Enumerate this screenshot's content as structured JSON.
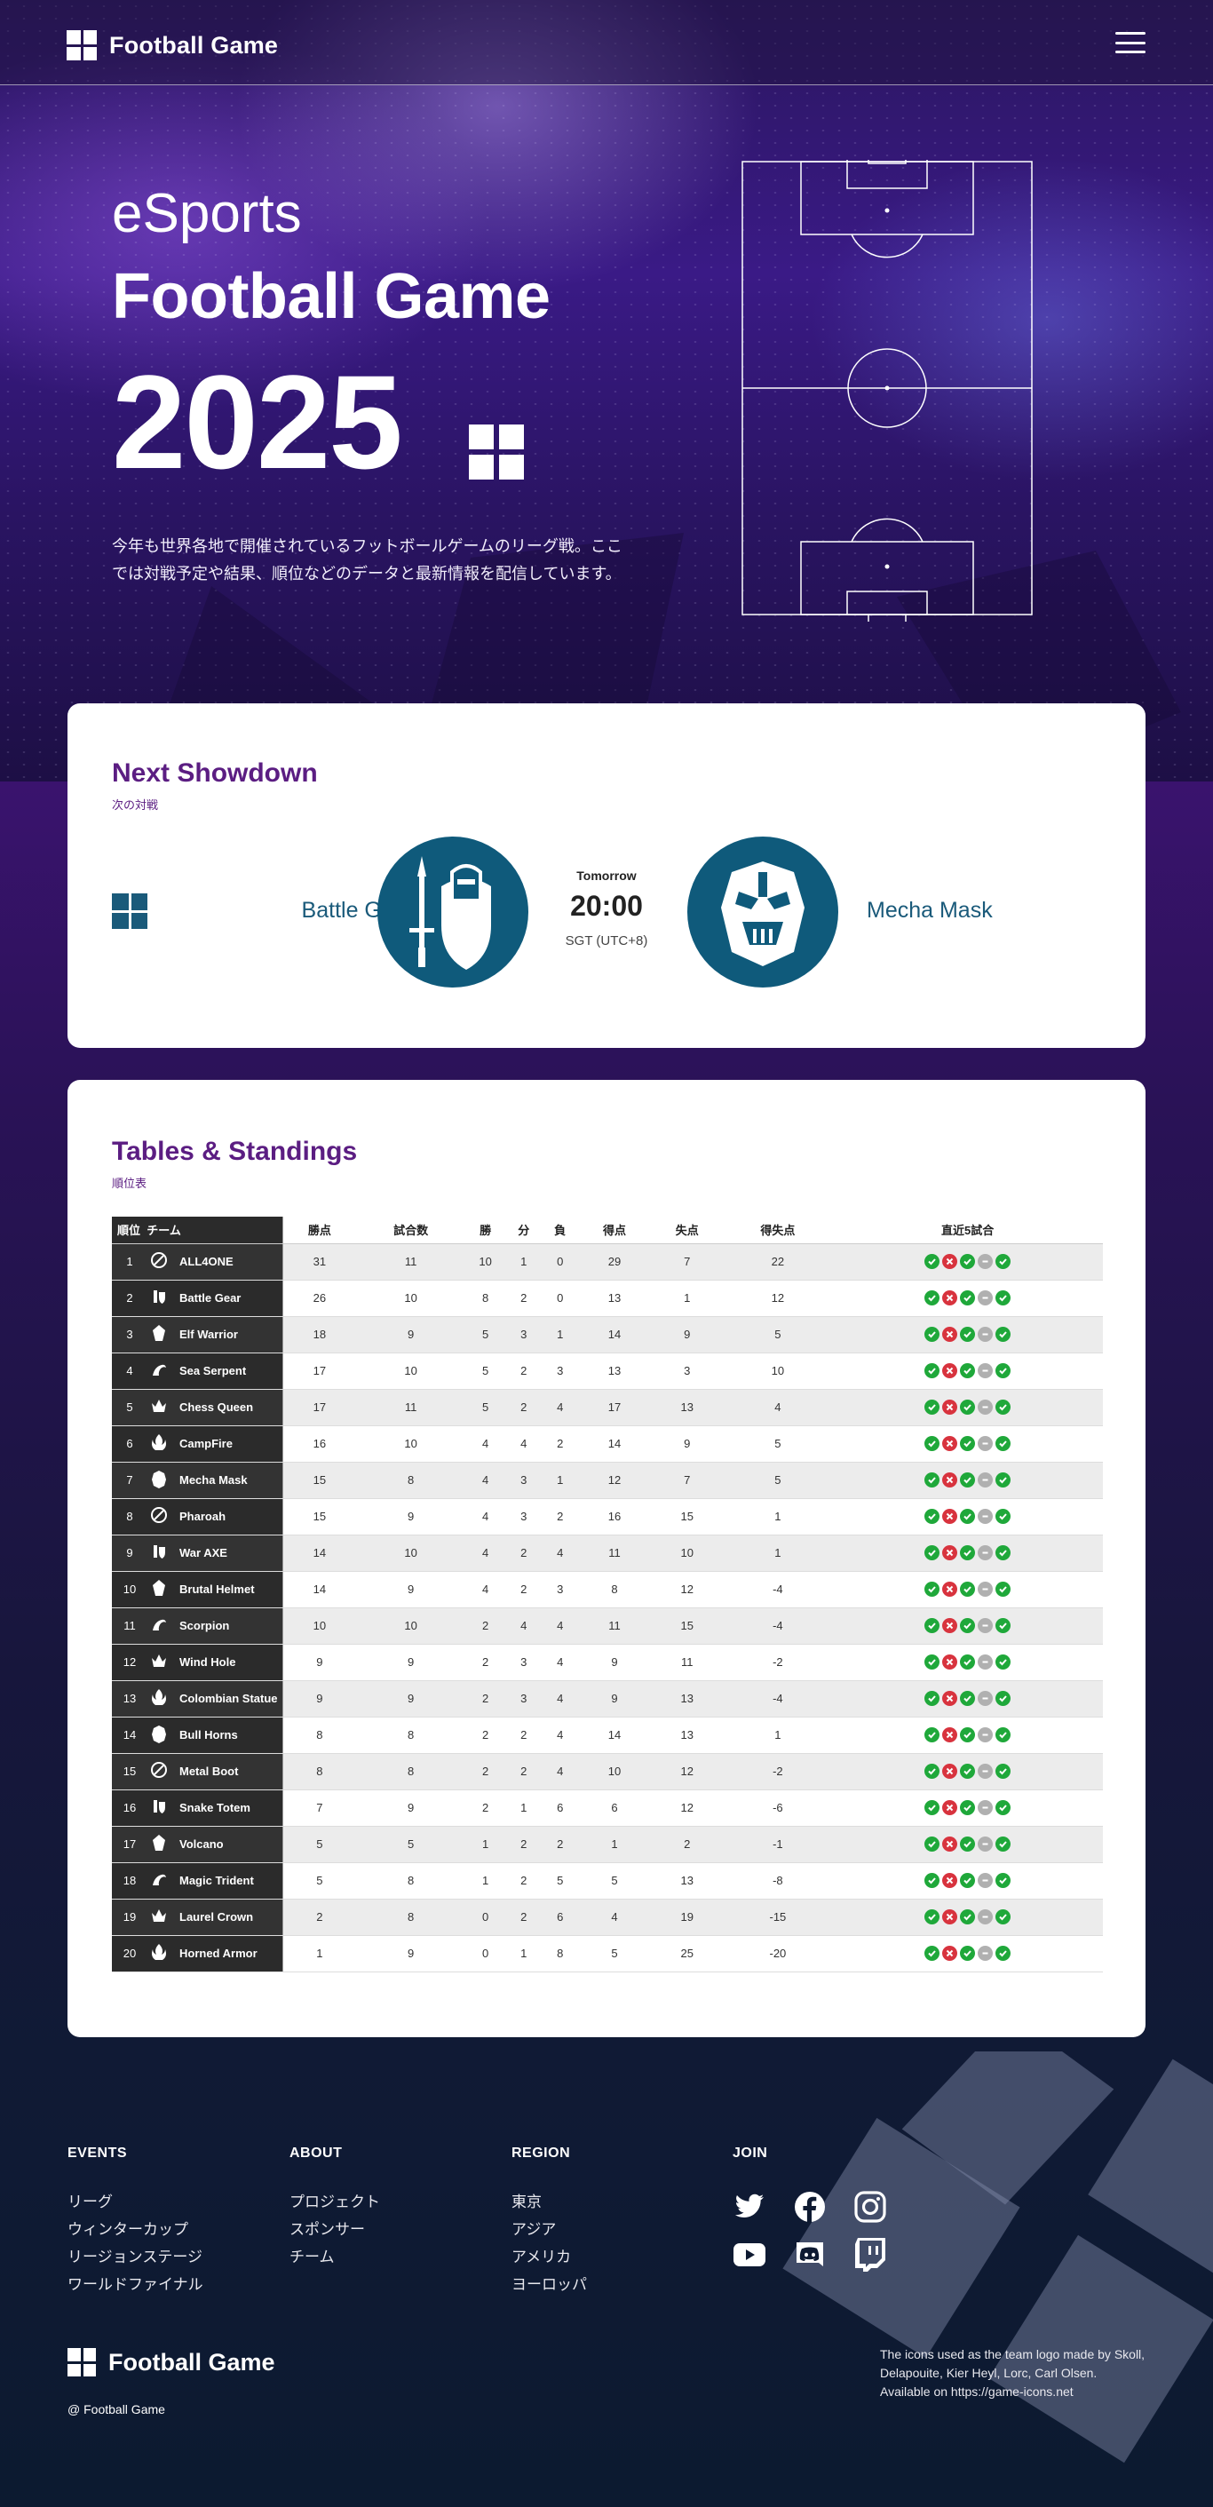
{
  "header": {
    "brand": "Football Game",
    "menu_icon": "hamburger-menu-icon"
  },
  "hero": {
    "eyebrow": "eSports",
    "title": "Football Game",
    "year": "2025",
    "description": "今年も世界各地で開催されているフットボールゲームのリーグ戦。ここでは対戦予定や結果、順位などのデータと最新情報を配信しています。"
  },
  "next_match": {
    "title": "Next Showdown",
    "subtitle": "次の対戦",
    "home_team": "Battle Gear",
    "away_team": "Mecha Mask",
    "day": "Tomorrow",
    "time": "20:00",
    "timezone": "SGT (UTC+8)",
    "home_icon": "knight-sword-shield-icon",
    "away_icon": "mecha-mask-icon"
  },
  "standings": {
    "title": "Tables & Standings",
    "subtitle": "順位表",
    "columns": [
      "順位",
      "チーム",
      "勝点",
      "試合数",
      "勝",
      "分",
      "負",
      "得点",
      "失点",
      "得失点",
      "直近5試合"
    ],
    "rows": [
      {
        "pos": "1",
        "team": "ALL4ONE",
        "pts": "31",
        "played": "11",
        "w": "10",
        "d": "1",
        "l": "0",
        "gf": "29",
        "ga": "7",
        "gd": "22",
        "form": [
          "W",
          "L",
          "W",
          "D",
          "W"
        ]
      },
      {
        "pos": "2",
        "team": "Battle Gear",
        "pts": "26",
        "played": "10",
        "w": "8",
        "d": "2",
        "l": "0",
        "gf": "13",
        "ga": "1",
        "gd": "12",
        "form": [
          "W",
          "L",
          "W",
          "D",
          "W"
        ]
      },
      {
        "pos": "3",
        "team": "Elf Warrior",
        "pts": "18",
        "played": "9",
        "w": "5",
        "d": "3",
        "l": "1",
        "gf": "14",
        "ga": "9",
        "gd": "5",
        "form": [
          "W",
          "L",
          "W",
          "D",
          "W"
        ]
      },
      {
        "pos": "4",
        "team": "Sea Serpent",
        "pts": "17",
        "played": "10",
        "w": "5",
        "d": "2",
        "l": "3",
        "gf": "13",
        "ga": "3",
        "gd": "10",
        "form": [
          "W",
          "L",
          "W",
          "D",
          "W"
        ]
      },
      {
        "pos": "5",
        "team": "Chess Queen",
        "pts": "17",
        "played": "11",
        "w": "5",
        "d": "2",
        "l": "4",
        "gf": "17",
        "ga": "13",
        "gd": "4",
        "form": [
          "W",
          "L",
          "W",
          "D",
          "W"
        ]
      },
      {
        "pos": "6",
        "team": "CampFire",
        "pts": "16",
        "played": "10",
        "w": "4",
        "d": "4",
        "l": "2",
        "gf": "14",
        "ga": "9",
        "gd": "5",
        "form": [
          "W",
          "L",
          "W",
          "D",
          "W"
        ]
      },
      {
        "pos": "7",
        "team": "Mecha Mask",
        "pts": "15",
        "played": "8",
        "w": "4",
        "d": "3",
        "l": "1",
        "gf": "12",
        "ga": "7",
        "gd": "5",
        "form": [
          "W",
          "L",
          "W",
          "D",
          "W"
        ]
      },
      {
        "pos": "8",
        "team": "Pharoah",
        "pts": "15",
        "played": "9",
        "w": "4",
        "d": "3",
        "l": "2",
        "gf": "16",
        "ga": "15",
        "gd": "1",
        "form": [
          "W",
          "L",
          "W",
          "D",
          "W"
        ]
      },
      {
        "pos": "9",
        "team": "War AXE",
        "pts": "14",
        "played": "10",
        "w": "4",
        "d": "2",
        "l": "4",
        "gf": "11",
        "ga": "10",
        "gd": "1",
        "form": [
          "W",
          "L",
          "W",
          "D",
          "W"
        ]
      },
      {
        "pos": "10",
        "team": "Brutal Helmet",
        "pts": "14",
        "played": "9",
        "w": "4",
        "d": "2",
        "l": "3",
        "gf": "8",
        "ga": "12",
        "gd": "-4",
        "form": [
          "W",
          "L",
          "W",
          "D",
          "W"
        ]
      },
      {
        "pos": "11",
        "team": "Scorpion",
        "pts": "10",
        "played": "10",
        "w": "2",
        "d": "4",
        "l": "4",
        "gf": "11",
        "ga": "15",
        "gd": "-4",
        "form": [
          "W",
          "L",
          "W",
          "D",
          "W"
        ]
      },
      {
        "pos": "12",
        "team": "Wind Hole",
        "pts": "9",
        "played": "9",
        "w": "2",
        "d": "3",
        "l": "4",
        "gf": "9",
        "ga": "11",
        "gd": "-2",
        "form": [
          "W",
          "L",
          "W",
          "D",
          "W"
        ]
      },
      {
        "pos": "13",
        "team": "Colombian Statue",
        "pts": "9",
        "played": "9",
        "w": "2",
        "d": "3",
        "l": "4",
        "gf": "9",
        "ga": "13",
        "gd": "-4",
        "form": [
          "W",
          "L",
          "W",
          "D",
          "W"
        ]
      },
      {
        "pos": "14",
        "team": "Bull Horns",
        "pts": "8",
        "played": "8",
        "w": "2",
        "d": "2",
        "l": "4",
        "gf": "14",
        "ga": "13",
        "gd": "1",
        "form": [
          "W",
          "L",
          "W",
          "D",
          "W"
        ]
      },
      {
        "pos": "15",
        "team": "Metal Boot",
        "pts": "8",
        "played": "8",
        "w": "2",
        "d": "2",
        "l": "4",
        "gf": "10",
        "ga": "12",
        "gd": "-2",
        "form": [
          "W",
          "L",
          "W",
          "D",
          "W"
        ]
      },
      {
        "pos": "16",
        "team": "Snake Totem",
        "pts": "7",
        "played": "9",
        "w": "2",
        "d": "1",
        "l": "6",
        "gf": "6",
        "ga": "12",
        "gd": "-6",
        "form": [
          "W",
          "L",
          "W",
          "D",
          "W"
        ]
      },
      {
        "pos": "17",
        "team": "Volcano",
        "pts": "5",
        "played": "5",
        "w": "1",
        "d": "2",
        "l": "2",
        "gf": "1",
        "ga": "2",
        "gd": "-1",
        "form": [
          "W",
          "L",
          "W",
          "D",
          "W"
        ]
      },
      {
        "pos": "18",
        "team": "Magic Trident",
        "pts": "5",
        "played": "8",
        "w": "1",
        "d": "2",
        "l": "5",
        "gf": "5",
        "ga": "13",
        "gd": "-8",
        "form": [
          "W",
          "L",
          "W",
          "D",
          "W"
        ]
      },
      {
        "pos": "19",
        "team": "Laurel Crown",
        "pts": "2",
        "played": "8",
        "w": "0",
        "d": "2",
        "l": "6",
        "gf": "4",
        "ga": "19",
        "gd": "-15",
        "form": [
          "W",
          "L",
          "W",
          "D",
          "W"
        ]
      },
      {
        "pos": "20",
        "team": "Horned Armor",
        "pts": "1",
        "played": "9",
        "w": "0",
        "d": "1",
        "l": "8",
        "gf": "5",
        "ga": "25",
        "gd": "-20",
        "form": [
          "W",
          "L",
          "W",
          "D",
          "W"
        ]
      }
    ]
  },
  "footer": {
    "columns": [
      {
        "title": "EVENTS",
        "links": [
          "リーグ",
          "ウィンターカップ",
          "リージョンステージ",
          "ワールドファイナル"
        ]
      },
      {
        "title": "ABOUT",
        "links": [
          "プロジェクト",
          "スポンサー",
          "チーム"
        ]
      },
      {
        "title": "REGION",
        "links": [
          "東京",
          "アジア",
          "アメリカ",
          "ヨーロッパ"
        ]
      }
    ],
    "join_title": "JOIN",
    "social": [
      "twitter-icon",
      "facebook-icon",
      "instagram-icon",
      "youtube-icon",
      "discord-icon",
      "twitch-icon"
    ],
    "brand": "Football Game",
    "copyright": "@ Football Game",
    "credit": "The icons used as the team logo made by Skoll, Delapouite, Kier Heyl, Lorc, Carl Olsen. Available on https://game-icons.net"
  },
  "colors": {
    "accent_purple": "#5b1d82",
    "team_teal": "#0f5a7b",
    "win": "#1fa83a",
    "loss": "#d8333e",
    "draw": "#b0b0b0"
  }
}
